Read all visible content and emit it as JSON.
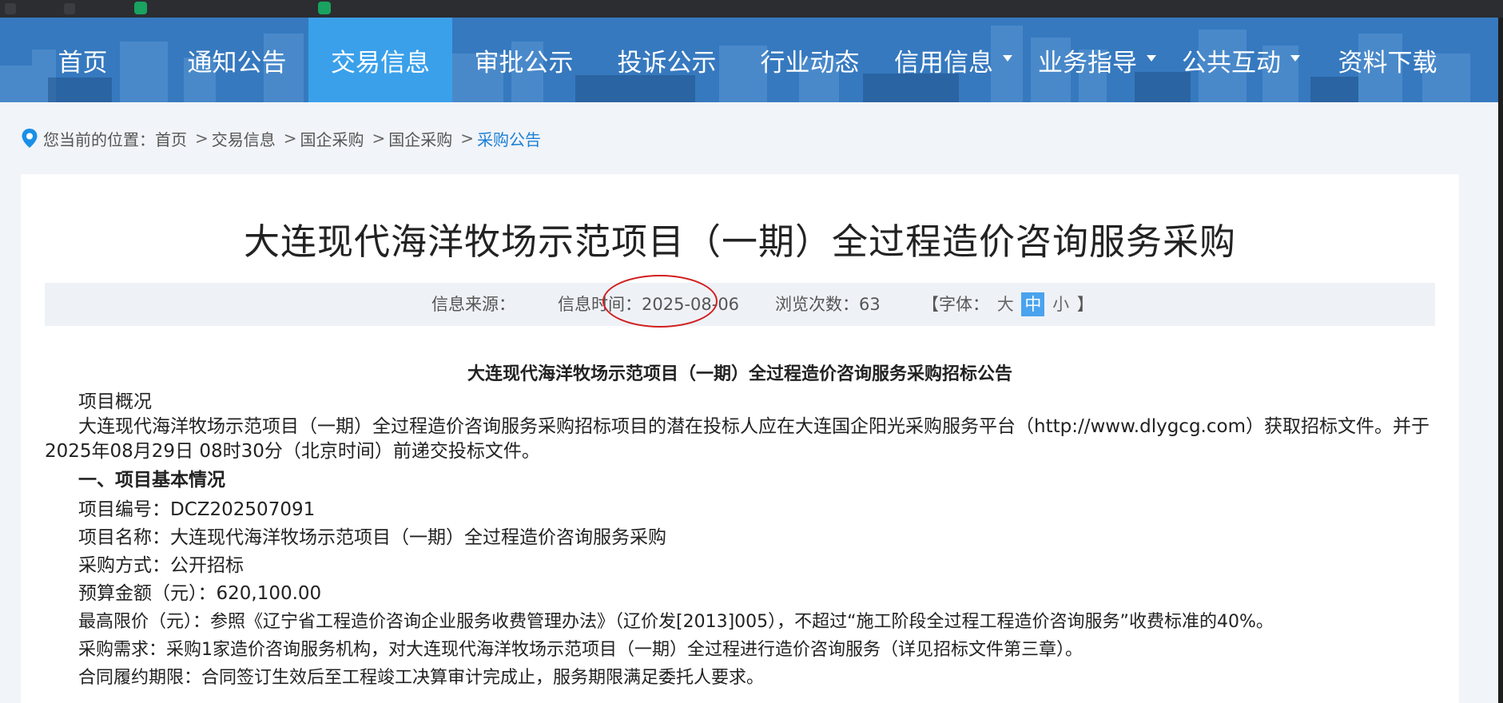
{
  "nav": {
    "items": [
      {
        "label": "首页",
        "active": false,
        "dropdown": false
      },
      {
        "label": "通知公告",
        "active": false,
        "dropdown": false
      },
      {
        "label": "交易信息",
        "active": true,
        "dropdown": false
      },
      {
        "label": "审批公示",
        "active": false,
        "dropdown": false
      },
      {
        "label": "投诉公示",
        "active": false,
        "dropdown": false
      },
      {
        "label": "行业动态",
        "active": false,
        "dropdown": false
      },
      {
        "label": "信用信息",
        "active": false,
        "dropdown": true
      },
      {
        "label": "业务指导",
        "active": false,
        "dropdown": true
      },
      {
        "label": "公共互动",
        "active": false,
        "dropdown": true
      },
      {
        "label": "资料下载",
        "active": false,
        "dropdown": false
      }
    ]
  },
  "breadcrumb": {
    "prefix": "您当前的位置：",
    "items": [
      "首页",
      "交易信息",
      "国企采购",
      "国企采购",
      "采购公告"
    ],
    "separator": ">"
  },
  "article": {
    "title": "大连现代海洋牧场示范项目（一期）全过程造价咨询服务采购",
    "meta": {
      "source_label": "信息来源：",
      "time_label": "信息时间：",
      "time_value": "2025-08-06",
      "views_label": "浏览次数：",
      "views_value": "63",
      "font_label": "【字体：",
      "font_large": "大",
      "font_medium": "中",
      "font_small": "小",
      "font_close": "】"
    },
    "doc_heading": "大连现代海洋牧场示范项目（一期）全过程造价咨询服务采购招标公告",
    "overview_label": "项目概况",
    "overview_para": "大连现代海洋牧场示范项目（一期）全过程造价咨询服务采购招标项目的潜在投标人应在大连国企阳光采购服务平台（http://www.dlygcg.com）获取招标文件。并于2025年08月29日 08时30分（北京时间）前递交投标文件。",
    "section1": "一、项目基本情况",
    "project_no": "项目编号：DCZ202507091",
    "project_name": "项目名称：大连现代海洋牧场示范项目（一期）全过程造价咨询服务采购",
    "method": "采购方式：公开招标",
    "budget": "预算金额（元）：620,100.00",
    "max_price": "最高限价（元）：参照《辽宁省工程造价咨询企业服务收费管理办法》（辽价发[2013]005），不超过“施工阶段全过程工程造价咨询服务”收费标准的40%。",
    "demand": " 采购需求：采购1家造价咨询服务机构，对大连现代海洋牧场示范项目（一期）全过程进行造价咨询服务（详见招标文件第三章）。",
    "contract_period": " 合同履约期限：合同签订生效后至工程竣工决算审计完成止，服务期限满足委托人要求。"
  },
  "colors": {
    "nav_bg": "#2b6fb6",
    "nav_active": "#3aa0ea",
    "link": "#1a7fd6",
    "annotation_circle": "#d21f1f"
  }
}
